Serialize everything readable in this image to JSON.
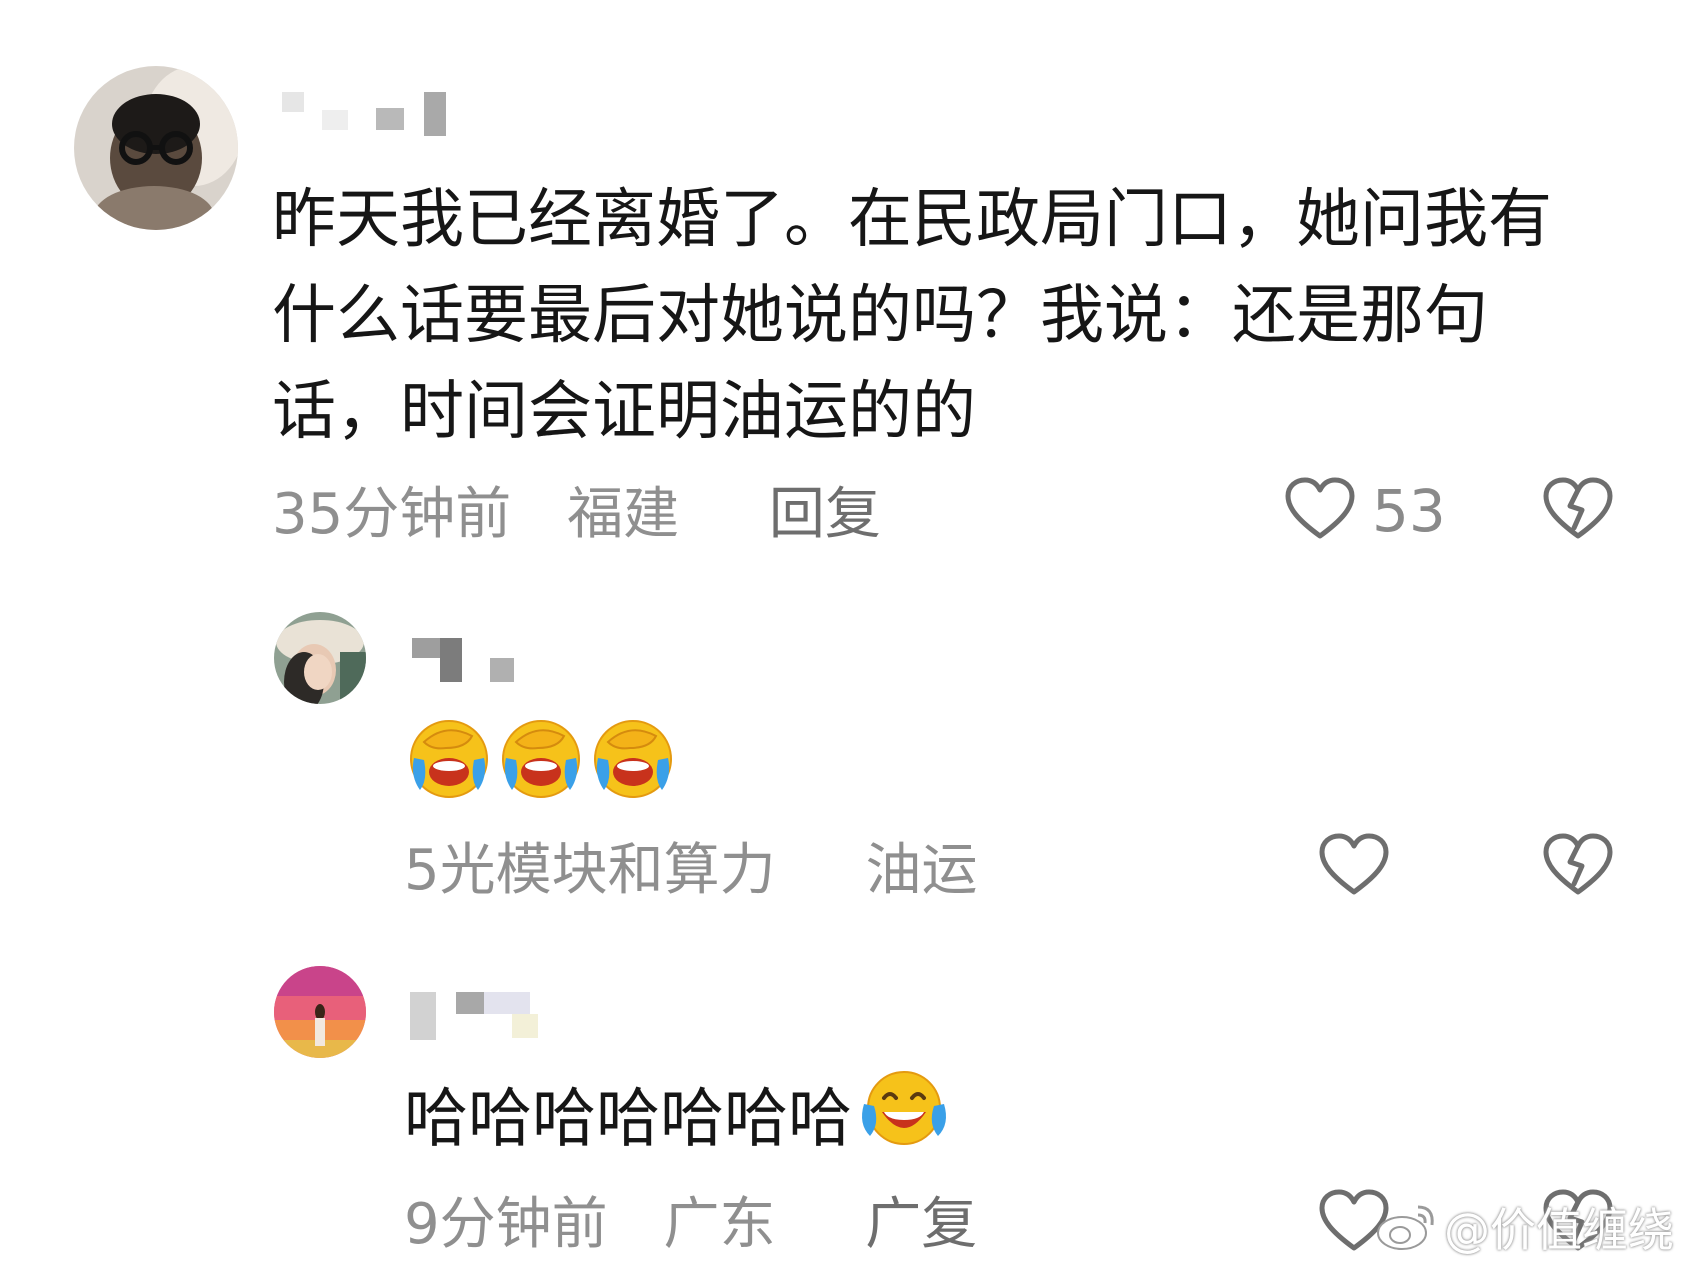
{
  "comments": [
    {
      "text": "昨天我已经离婚了。在民政局门口，她问我有什么话要最后对她说的吗？我说：还是那句话，时间会证明油运的的",
      "lines": [
        "昨天我已经离婚了。在民政局门口，她问我有",
        "什么话要最后对她说的吗？我说：还是那句",
        "话，时间会证明油运的的"
      ],
      "time": "35分钟前",
      "location": "福建",
      "reply_label": "回复",
      "like_count": "53"
    },
    {
      "emoji": [
        "crying-laughing-cover-face",
        "crying-laughing-cover-face",
        "crying-laughing-cover-face"
      ],
      "time": "5光模块和算力",
      "location": "油运"
    },
    {
      "text": "哈哈哈哈哈哈哈",
      "emoji": [
        "tears-of-joy"
      ],
      "time": "9分钟前",
      "location": "广东",
      "reply_label": "广复"
    }
  ],
  "watermark": "@价值缠绕"
}
